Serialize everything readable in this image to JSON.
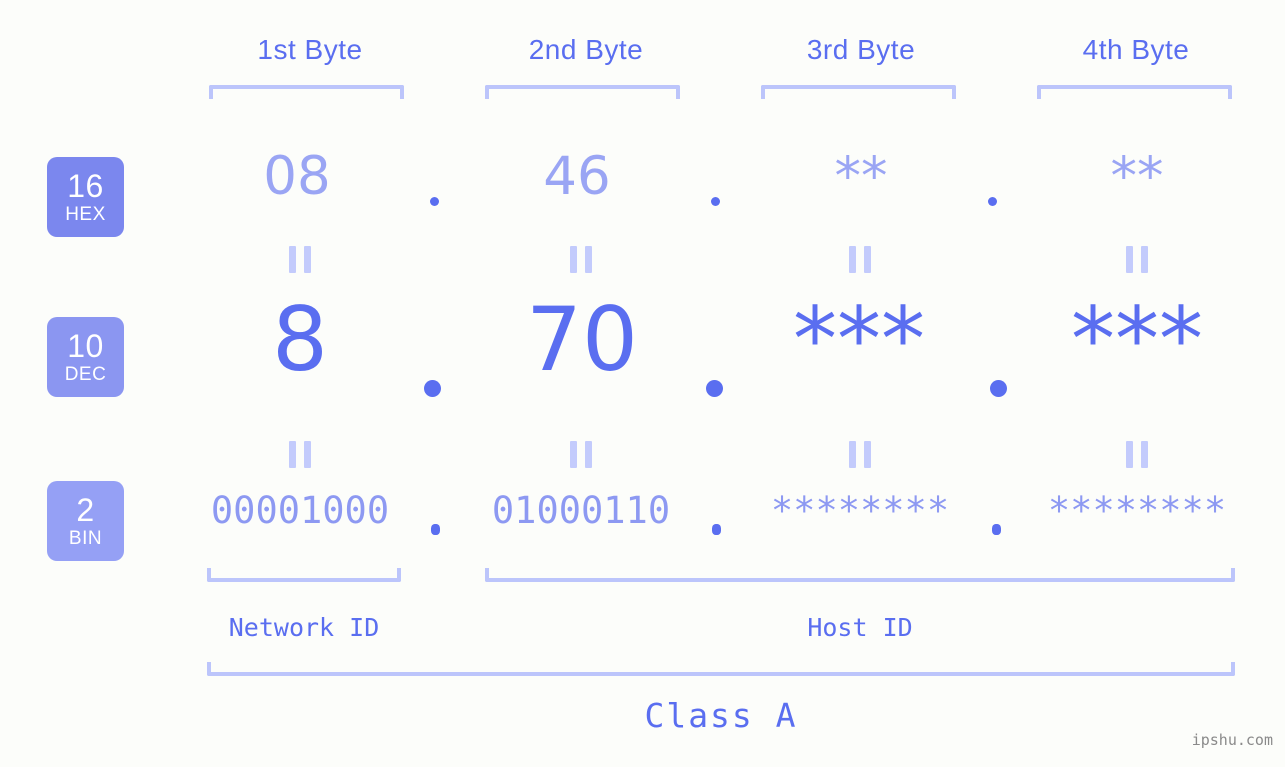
{
  "background_color": "#fcfdfa",
  "accent_color": "#5a6ef0",
  "headers": [
    {
      "label": "1st Byte"
    },
    {
      "label": "2nd Byte"
    },
    {
      "label": "3rd Byte"
    },
    {
      "label": "4th Byte"
    }
  ],
  "rows": [
    {
      "radix": "16",
      "radix_label": "HEX",
      "badge_color": "#7b87ee",
      "values": [
        "08",
        "46",
        "**",
        "**"
      ],
      "separator": "."
    },
    {
      "radix": "10",
      "radix_label": "DEC",
      "badge_color": "#8b96f1",
      "values": [
        "8",
        "70",
        "***",
        "***"
      ],
      "separator": "."
    },
    {
      "radix": "2",
      "radix_label": "BIN",
      "badge_color": "#95a0f5",
      "values": [
        "00001000",
        "01000110",
        "********",
        "********"
      ],
      "separator": "."
    }
  ],
  "equals_symbol": "=",
  "segments": {
    "network_id": "Network ID",
    "host_id": "Host ID"
  },
  "class_label": "Class A",
  "watermark": "ipshu.com"
}
